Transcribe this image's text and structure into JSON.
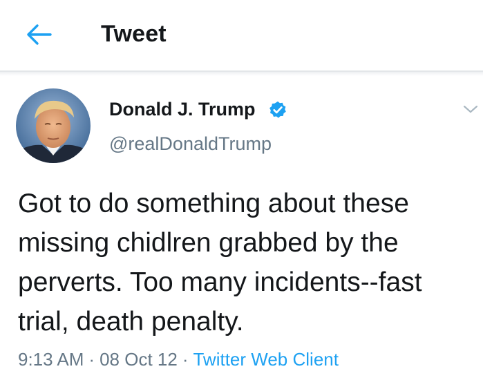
{
  "header": {
    "title": "Tweet",
    "back_icon": "arrow-left-icon"
  },
  "tweet": {
    "author_name": "Donald J. Trump",
    "handle": "@realDonaldTrump",
    "verified_icon": "verified-badge-icon",
    "menu_icon": "chevron-down-icon",
    "text": "Got to do something about these\nmissing chidlren grabbed by the\nperverts. Too many incidents--fast\ntrial, death penalty.",
    "time": "9:13 AM",
    "date": "08 Oct 12",
    "separator": "·",
    "client": "Twitter Web Client"
  },
  "colors": {
    "accent": "#1da1f2",
    "secondary_text": "#657786",
    "primary_text": "#14171a",
    "divider": "#e3e6e9"
  }
}
